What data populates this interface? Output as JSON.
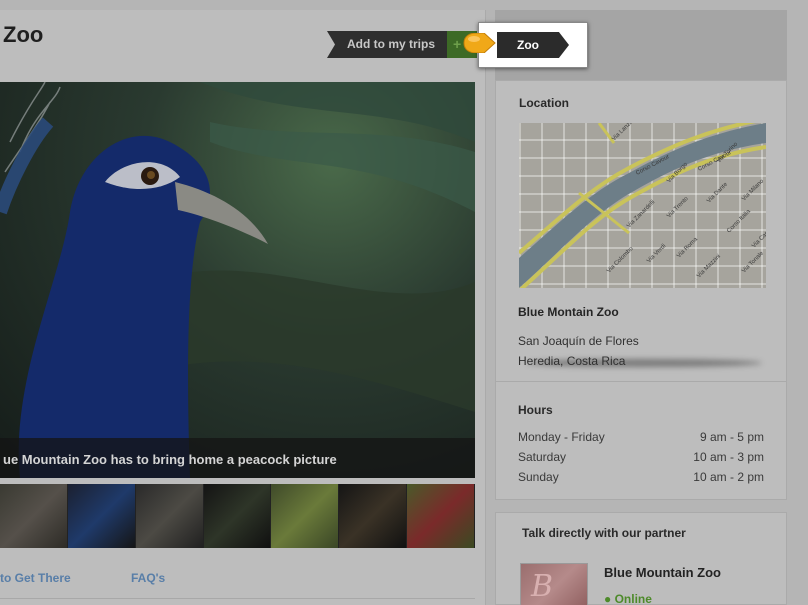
{
  "page": {
    "title": "Zoo"
  },
  "actions": {
    "add_to_trips_label": "Add to my trips",
    "add_icon": "+"
  },
  "tooltip": {
    "label": "Zoo"
  },
  "gallery": {
    "caption": "ue Mountain Zoo has to bring home a peacock picture",
    "thumbnail_count": 7
  },
  "bottom_links": [
    "to Get There",
    "FAQ's"
  ],
  "location": {
    "heading": "Location",
    "name": "Blue Montain Zoo",
    "address_line1": "San Joaquín de Flores",
    "address_line2": "Heredia, Costa Rica",
    "map_streets": [
      "Via Lanza",
      "Corso Cavour",
      "Via Zanardelli",
      "Via Trento",
      "Via Dante",
      "Corso Italia",
      "Via Roma",
      "Via Milano",
      "Via Torino",
      "Via Verdi",
      "Via Tonale",
      "Via Mazzini",
      "Via Colombo",
      "Via Carducci",
      "Via Borgo"
    ]
  },
  "hours": {
    "heading": "Hours",
    "rows": [
      {
        "day": "Monday - Friday",
        "time": "9 am - 5 pm"
      },
      {
        "day": "Saturday",
        "time": "10 am - 3 pm"
      },
      {
        "day": "Sunday",
        "time": "10 am - 2 pm"
      }
    ]
  },
  "partner": {
    "heading": "Talk directly with our partner",
    "name": "Blue Mountain Zoo",
    "status": "Online",
    "status_color": "#4d8a2a",
    "logo_letter": "B"
  },
  "colors": {
    "overlay": "#b5b5b5",
    "link": "#587ea8",
    "pointer": "#f0a818"
  }
}
